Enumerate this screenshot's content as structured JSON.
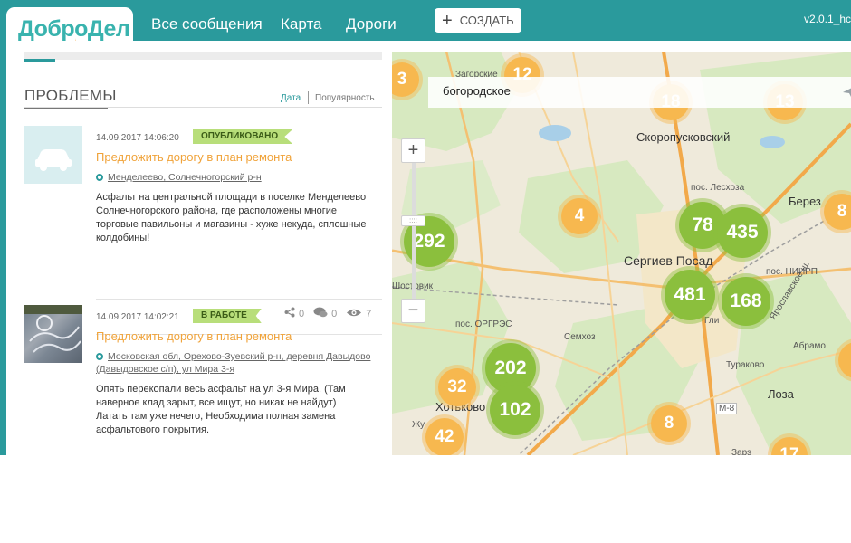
{
  "header": {
    "logo": "ДоброДел",
    "nav": [
      "Все сообщения",
      "Карта",
      "Дороги"
    ],
    "create_label": "СОЗДАТЬ",
    "version": "v2.0.1_hc"
  },
  "problems": {
    "title": "ПРОБЛЕМЫ",
    "sort_date": "Дата",
    "sort_popularity": "Популярность",
    "items": [
      {
        "time": "14.09.2017 14:06:20",
        "status": "ОПУБЛИКОВАНО",
        "title": "Предложить дорогу в план ремонта",
        "location": "Менделеево, Солнечногорский р-н",
        "text": "Асфальт на центральной площади в поселке Менделеево Солнечногорского района, где расположены многие торговые павильоны и магазины - хуже некуда, сплошные колдобины!",
        "shares": "0",
        "comments": "0",
        "views": "7"
      },
      {
        "time": "14.09.2017 14:02:21",
        "status": "В РАБОТЕ",
        "title": "Предложить дорогу в план ремонта",
        "location": "Московская обл, Орехово-Зуевский р-н, деревня Давыдово (Давыдовское с/п), ул Мира 3-я",
        "text": "Опять перекопали весь асфальт на ул 3-я Мира. (Там наверное клад зарыт, все ищут, но никак не найдут) Латать там уже нечего, Необходима полная замена асфальтового покрытия."
      }
    ]
  },
  "map": {
    "search_value": "богородское",
    "places": [
      "Загорские",
      "Скоропусковский",
      "пос. Лесхоза",
      "Берез",
      "Сергиев Посад",
      "пос. НИИРП",
      "Ярославское ш.",
      "Шостовик",
      "пос. ОРГРЭС",
      "Семхоз",
      "Гли",
      "Абрамо",
      "Тураково",
      "Лоза",
      "Хотьково",
      "М-8",
      "Жу",
      "Зарэ"
    ],
    "clusters": [
      {
        "label": "3",
        "color": "orange"
      },
      {
        "label": "12",
        "color": "orange"
      },
      {
        "label": "18",
        "color": "orange"
      },
      {
        "label": "13",
        "color": "orange"
      },
      {
        "label": "4",
        "color": "orange"
      },
      {
        "label": "8",
        "color": "orange"
      },
      {
        "label": "292",
        "color": "green"
      },
      {
        "label": "78",
        "color": "green"
      },
      {
        "label": "435",
        "color": "green"
      },
      {
        "label": "481",
        "color": "green"
      },
      {
        "label": "168",
        "color": "green"
      },
      {
        "label": "202",
        "color": "green"
      },
      {
        "label": "102",
        "color": "green"
      },
      {
        "label": "32",
        "color": "orange"
      },
      {
        "label": "42",
        "color": "orange"
      },
      {
        "label": "8",
        "color": "orange"
      },
      {
        "label": "17",
        "color": "orange"
      },
      {
        "label": "2",
        "color": "orange"
      }
    ]
  },
  "colors": {
    "brand": "#2a9a9c",
    "accent": "#f0a33a",
    "cluster_orange": "#f7b84f",
    "cluster_green": "#8bbf3d"
  }
}
